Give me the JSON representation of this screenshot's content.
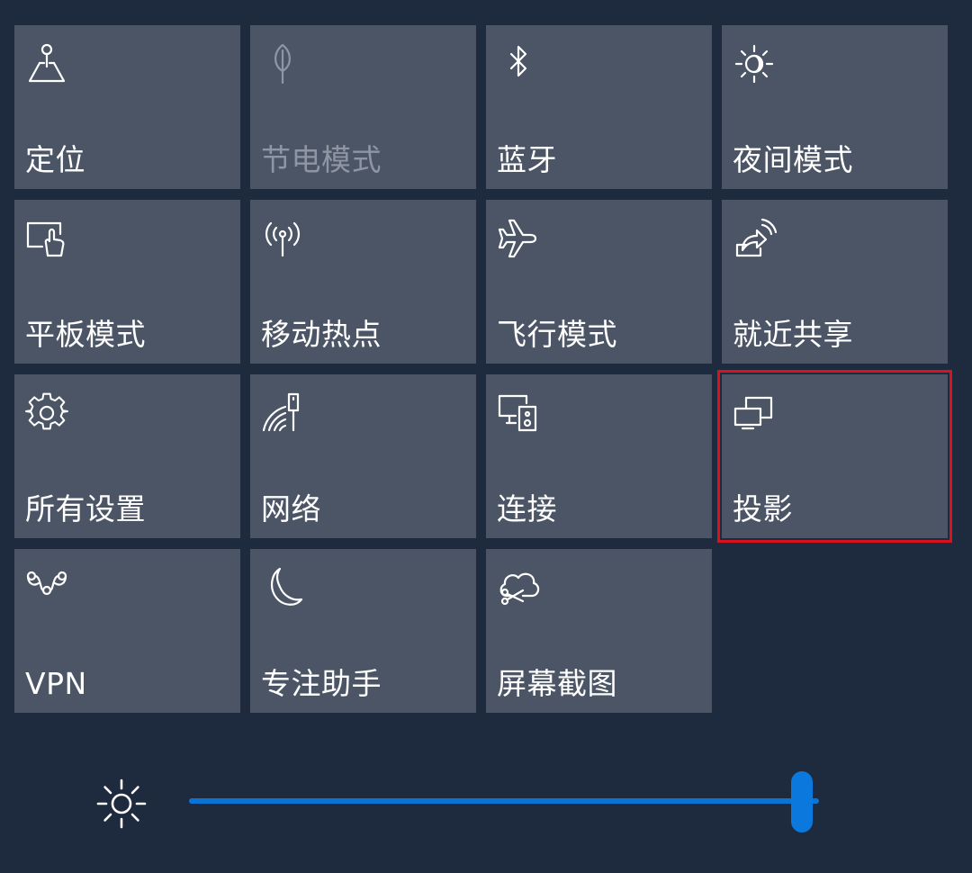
{
  "tiles": [
    {
      "label": "定位",
      "icon": "location-icon",
      "state": "normal"
    },
    {
      "label": "节电模式",
      "icon": "battery-saver-icon",
      "state": "disabled"
    },
    {
      "label": "蓝牙",
      "icon": "bluetooth-icon",
      "state": "normal"
    },
    {
      "label": "夜间模式",
      "icon": "night-light-icon",
      "state": "normal"
    },
    {
      "label": "平板模式",
      "icon": "tablet-mode-icon",
      "state": "normal"
    },
    {
      "label": "移动热点",
      "icon": "mobile-hotspot-icon",
      "state": "normal"
    },
    {
      "label": "飞行模式",
      "icon": "airplane-icon",
      "state": "normal"
    },
    {
      "label": "就近共享",
      "icon": "nearby-share-icon",
      "state": "normal"
    },
    {
      "label": "所有设置",
      "icon": "gear-icon",
      "state": "normal"
    },
    {
      "label": "网络",
      "icon": "network-icon",
      "state": "normal"
    },
    {
      "label": "连接",
      "icon": "connect-icon",
      "state": "normal"
    },
    {
      "label": "投影",
      "icon": "project-icon",
      "state": "highlighted"
    },
    {
      "label": "VPN",
      "icon": "vpn-icon",
      "state": "normal"
    },
    {
      "label": "专注助手",
      "icon": "moon-icon",
      "state": "normal"
    },
    {
      "label": "屏幕截图",
      "icon": "snip-icon",
      "state": "normal"
    }
  ],
  "brightness": {
    "icon": "brightness-sun-icon",
    "level": 0.99
  },
  "colors": {
    "background": "#1e2a3d",
    "tile": "#4b5565",
    "accent": "#0a78dc",
    "highlight": "#d9131e",
    "disabled_text": "#8e96a3"
  }
}
